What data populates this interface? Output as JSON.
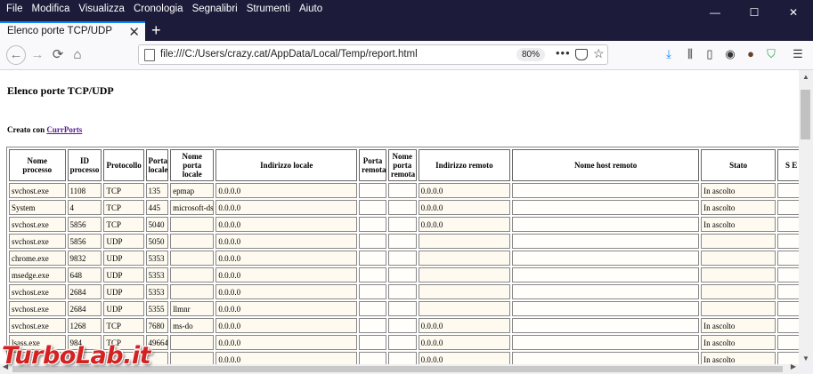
{
  "menu": [
    "File",
    "Modifica",
    "Visualizza",
    "Cronologia",
    "Segnalibri",
    "Strumenti",
    "Aiuto"
  ],
  "window_controls": {
    "minimize": "—",
    "maximize": "☐",
    "close": "✕"
  },
  "tab": {
    "title": "Elenco porte TCP/UDP",
    "close": "✕",
    "new_tab": "+"
  },
  "nav": {
    "url": "file:///C:/Users/crazy.cat/AppData/Local/Temp/report.html",
    "zoom": "80%",
    "more": "•••"
  },
  "page": {
    "heading": "Elenco porte TCP/UDP",
    "created_with": "Creato con",
    "link": "CurrPorts"
  },
  "table": {
    "headers": [
      "Nome processo",
      "ID processo",
      "Protocollo",
      "Porta locale",
      "Nome porta locale",
      "Indirizzo locale",
      "Porta remota",
      "Nome porta remota",
      "Indirizzo remoto",
      "Nome host remoto",
      "Stato",
      "S E"
    ],
    "rows": [
      [
        "svchost.exe",
        "1108",
        "TCP",
        "135",
        "epmap",
        "0.0.0.0",
        "",
        "",
        "0.0.0.0",
        "",
        "In ascolto"
      ],
      [
        "System",
        "4",
        "TCP",
        "445",
        "microsoft-ds",
        "0.0.0.0",
        "",
        "",
        "0.0.0.0",
        "",
        "In ascolto"
      ],
      [
        "svchost.exe",
        "5856",
        "TCP",
        "5040",
        "",
        "0.0.0.0",
        "",
        "",
        "0.0.0.0",
        "",
        "In ascolto"
      ],
      [
        "svchost.exe",
        "5856",
        "UDP",
        "5050",
        "",
        "0.0.0.0",
        "",
        "",
        "",
        "",
        ""
      ],
      [
        "chrome.exe",
        "9832",
        "UDP",
        "5353",
        "",
        "0.0.0.0",
        "",
        "",
        "",
        "",
        ""
      ],
      [
        "msedge.exe",
        "648",
        "UDP",
        "5353",
        "",
        "0.0.0.0",
        "",
        "",
        "",
        "",
        ""
      ],
      [
        "svchost.exe",
        "2684",
        "UDP",
        "5353",
        "",
        "0.0.0.0",
        "",
        "",
        "",
        "",
        ""
      ],
      [
        "svchost.exe",
        "2684",
        "UDP",
        "5355",
        "llmnr",
        "0.0.0.0",
        "",
        "",
        "",
        "",
        ""
      ],
      [
        "svchost.exe",
        "1268",
        "TCP",
        "7680",
        "ms-do",
        "0.0.0.0",
        "",
        "",
        "0.0.0.0",
        "",
        "In ascolto"
      ],
      [
        "lsass.exe",
        "984",
        "TCP",
        "49664",
        "",
        "0.0.0.0",
        "",
        "",
        "0.0.0.0",
        "",
        "In ascolto"
      ],
      [
        "",
        "",
        "",
        "",
        "",
        "0.0.0.0",
        "",
        "",
        "0.0.0.0",
        "",
        "In ascolto"
      ]
    ]
  },
  "watermark": "TurboLab.it"
}
